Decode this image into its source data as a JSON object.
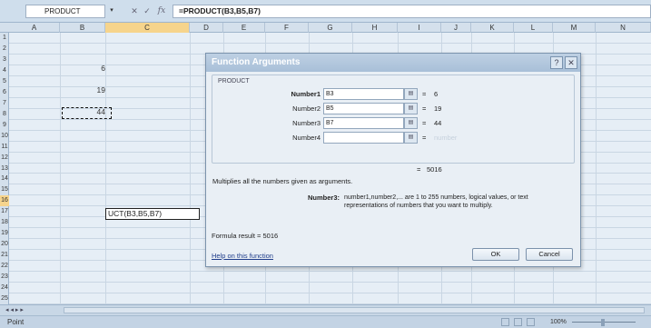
{
  "formula_bar": {
    "name_box": "PRODUCT",
    "dropdown_glyph": "▾",
    "cancel_glyph": "✕",
    "enter_glyph": "✓",
    "fx_glyph": "fx",
    "formula": "=PRODUCT(B3,B5,B7)"
  },
  "columns": [
    "A",
    "B",
    "C",
    "D",
    "E",
    "F",
    "G",
    "H",
    "I",
    "J",
    "K",
    "L",
    "M",
    "N"
  ],
  "rows": [
    "1",
    "2",
    "3",
    "4",
    "5",
    "6",
    "7",
    "8",
    "9",
    "10",
    "11",
    "12",
    "13",
    "14",
    "15",
    "16",
    "17",
    "18",
    "19",
    "20",
    "21",
    "22",
    "23",
    "24",
    "25"
  ],
  "cells": {
    "b3": "6",
    "b5": "19",
    "b7": "44",
    "c16": "UCT(B3,B5,B7)"
  },
  "dialog": {
    "title": "Function Arguments",
    "help_glyph": "?",
    "close_glyph": "✕",
    "function_name": "PRODUCT",
    "args": [
      {
        "label": "Number1",
        "value": "B3",
        "result": "6"
      },
      {
        "label": "Number2",
        "value": "B5",
        "result": "19"
      },
      {
        "label": "Number3",
        "value": "B7",
        "result": "44"
      },
      {
        "label": "Number4",
        "value": "",
        "result": "number"
      }
    ],
    "ref_button_glyph": "▤",
    "equals": "=",
    "total_result": "5016",
    "description": "Multiplies all the numbers given as arguments.",
    "arg_desc_label": "Number3:",
    "arg_desc_text": "number1,number2,... are 1 to 255 numbers, logical values, or text representations of numbers that you want to multiply.",
    "formula_result": "Formula result =   5016",
    "help_link": "Help on this function",
    "ok_label": "OK",
    "cancel_label": "Cancel"
  },
  "status_bar": {
    "mode": "Point",
    "zoom": "100%",
    "nav_glyph": "◂ ◂ ▸ ▸"
  }
}
